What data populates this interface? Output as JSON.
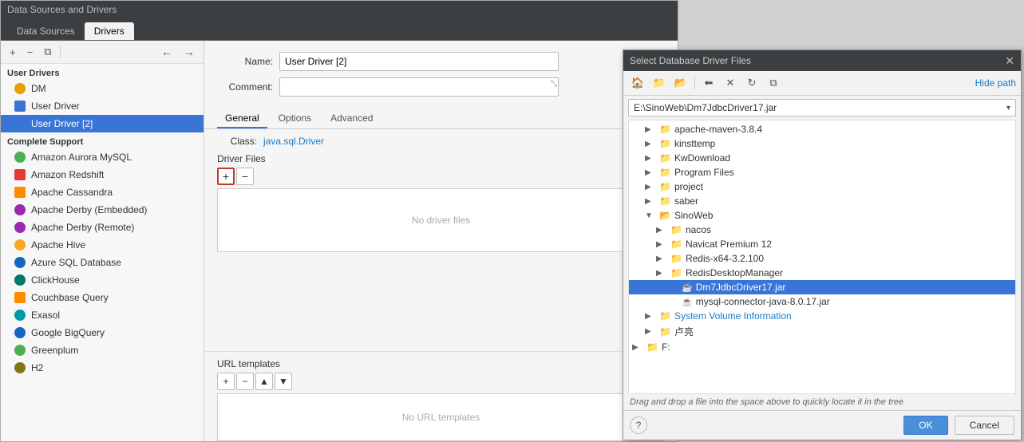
{
  "main_window": {
    "title": "Data Sources and Drivers",
    "tabs": [
      {
        "label": "Data Sources",
        "active": false
      },
      {
        "label": "Drivers",
        "active": true
      }
    ]
  },
  "sidebar": {
    "add_btn": "+",
    "remove_btn": "−",
    "copy_btn": "⧉",
    "back_btn": "←",
    "forward_btn": "→",
    "section_user_drivers": "User Drivers",
    "items_user": [
      {
        "label": "DM",
        "icon": "dm"
      },
      {
        "label": "User Driver",
        "icon": "user"
      },
      {
        "label": "User Driver [2]",
        "icon": "user",
        "selected": true
      }
    ],
    "section_complete": "Complete Support",
    "items_complete": [
      {
        "label": "Amazon Aurora MySQL",
        "icon": "green"
      },
      {
        "label": "Amazon Redshift",
        "icon": "red"
      },
      {
        "label": "Apache Cassandra",
        "icon": "orange"
      },
      {
        "label": "Apache Derby (Embedded)",
        "icon": "purple"
      },
      {
        "label": "Apache Derby (Remote)",
        "icon": "purple"
      },
      {
        "label": "Apache Hive",
        "icon": "yellow"
      },
      {
        "label": "Azure SQL Database",
        "icon": "blue"
      },
      {
        "label": "ClickHouse",
        "icon": "teal"
      },
      {
        "label": "Couchbase Query",
        "icon": "orange"
      },
      {
        "label": "Exasol",
        "icon": "cyan"
      },
      {
        "label": "Google BigQuery",
        "icon": "blue"
      },
      {
        "label": "Greenplum",
        "icon": "green"
      },
      {
        "label": "H2",
        "icon": "lime"
      }
    ]
  },
  "driver_form": {
    "name_label": "Name:",
    "name_value": "User Driver [2]",
    "comment_label": "Comment:",
    "comment_value": "",
    "comment_placeholder": "",
    "sub_tabs": [
      "General",
      "Options",
      "Advanced"
    ],
    "active_sub_tab": "General",
    "class_label": "Class:",
    "class_value": "java.sql.Driver",
    "driver_files_label": "Driver Files",
    "add_btn": "+",
    "remove_btn": "−",
    "no_driver_text": "No driver files",
    "url_templates_label": "URL templates",
    "url_add_btn": "+",
    "url_remove_btn": "−",
    "url_up_btn": "▲",
    "url_down_btn": "▼",
    "no_url_text": "No URL templates"
  },
  "file_dialog": {
    "title": "Select Database Driver Files",
    "hide_path": "Hide path",
    "path_value": "E:\\SinoWeb\\Dm7JdbcDriver17.jar",
    "tree_items": [
      {
        "label": "apache-maven-3.8.4",
        "type": "folder",
        "indent": 1,
        "expanded": false
      },
      {
        "label": "kinsttemp",
        "type": "folder",
        "indent": 1,
        "expanded": false
      },
      {
        "label": "KwDownload",
        "type": "folder",
        "indent": 1,
        "expanded": false
      },
      {
        "label": "Program Files",
        "type": "folder",
        "indent": 1,
        "expanded": false
      },
      {
        "label": "project",
        "type": "folder",
        "indent": 1,
        "expanded": false
      },
      {
        "label": "saber",
        "type": "folder",
        "indent": 1,
        "expanded": false
      },
      {
        "label": "SinoWeb",
        "type": "folder",
        "indent": 1,
        "expanded": true
      },
      {
        "label": "nacos",
        "type": "folder",
        "indent": 2,
        "expanded": false
      },
      {
        "label": "Navicat Premium 12",
        "type": "folder",
        "indent": 2,
        "expanded": false
      },
      {
        "label": "Redis-x64-3.2.100",
        "type": "folder",
        "indent": 2,
        "expanded": false
      },
      {
        "label": "RedisDesktopManager",
        "type": "folder",
        "indent": 2,
        "expanded": false
      },
      {
        "label": "Dm7JdbcDriver17.jar",
        "type": "file",
        "indent": 3,
        "selected": true
      },
      {
        "label": "mysql-connector-java-8.0.17.jar",
        "type": "file",
        "indent": 3,
        "selected": false
      },
      {
        "label": "System Volume Information",
        "type": "folder",
        "indent": 1,
        "expanded": false
      },
      {
        "label": "卢亮",
        "type": "folder",
        "indent": 1,
        "expanded": false
      },
      {
        "label": "F:",
        "type": "folder",
        "indent": 0,
        "expanded": false
      }
    ],
    "status_text": "Drag and drop a file into the space above to quickly locate it in the tree",
    "ok_btn": "OK",
    "cancel_btn": "Cancel"
  },
  "icons": {
    "home": "🏠",
    "folder_open": "📂",
    "folder_new": "📁",
    "back": "⬅",
    "delete": "✕",
    "refresh": "↻",
    "copy": "⧉",
    "help": "?",
    "chevron_down": "▾",
    "chevron_right": "▶",
    "folder": "📁",
    "jar_file": "☕",
    "db_icon": "🗄"
  }
}
